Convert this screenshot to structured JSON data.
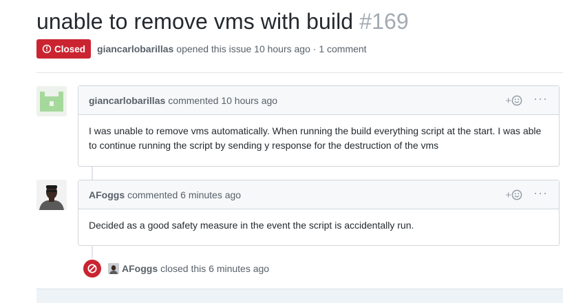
{
  "issue": {
    "title": "unable to remove vms with build",
    "number": "#169",
    "state_label": "Closed",
    "author": "giancarlobarillas",
    "opened_text": "opened this issue 10 hours ago · 1 comment"
  },
  "comments": [
    {
      "author": "giancarlobarillas",
      "timestamp": "commented 10 hours ago",
      "body": "I was unable to remove vms automatically. When running the build everything script at the start. I was able to continue running the script by sending y response for the destruction of the vms",
      "reaction_label": "+",
      "more_label": "···"
    },
    {
      "author": "AFoggs",
      "timestamp": "commented 6 minutes ago",
      "body": "Decided as a good safety measure in the event the script is accidentally run.",
      "reaction_label": "+",
      "more_label": "···"
    }
  ],
  "event": {
    "actor": "AFoggs",
    "text": "closed this 6 minutes ago"
  },
  "colors": {
    "closed_red": "#cb2431",
    "header_bg": "#f6f8fa",
    "border": "#d1d5da"
  },
  "icons": [
    "issue-closed-icon",
    "smiley-icon",
    "kebab-icon",
    "circle-slash-icon"
  ]
}
